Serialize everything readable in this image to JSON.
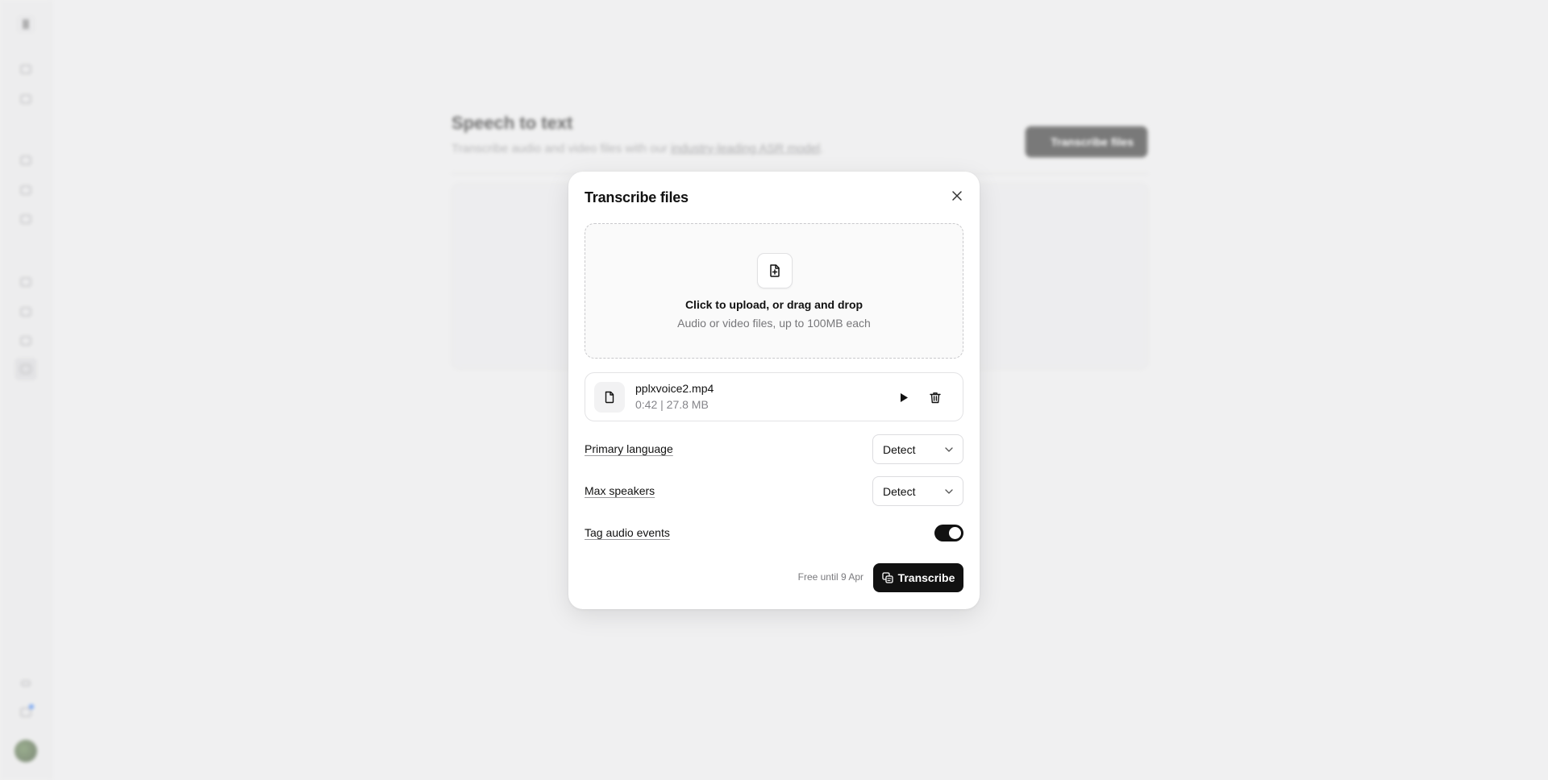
{
  "background": {
    "page_title": "Speech to text",
    "subtitle_prefix": "Transcribe audio and video files with our ",
    "subtitle_link": "industry-leading ASR model",
    "subtitle_suffix": ".",
    "header_button": "Transcribe files"
  },
  "sidebar": {
    "icons": [
      "home-icon",
      "voices-icon",
      "tts-icon",
      "voice-changer-icon",
      "sound-effects-icon",
      "dubbing-icon",
      "studio-icon",
      "voice-isolator-icon",
      "speech-to-text-icon"
    ],
    "active": "speech-to-text-icon"
  },
  "modal": {
    "title": "Transcribe files",
    "dropzone": {
      "title": "Click to upload, or drag and drop",
      "subtitle": "Audio or video files, up to 100MB each"
    },
    "file": {
      "name": "pplxvoice2.mp4",
      "meta": "0:42 | 27.8 MB"
    },
    "primary_language": {
      "label": "Primary language",
      "value": "Detect"
    },
    "max_speakers": {
      "label": "Max speakers",
      "value": "Detect"
    },
    "tag_audio_events": {
      "label": "Tag audio events",
      "enabled": true
    },
    "free_note": "Free until 9 Apr",
    "submit_label": "Transcribe"
  },
  "colors": {
    "accent": "#111111",
    "backdrop": "#f0f0f1",
    "notification_dot": "#2f7bf6"
  }
}
